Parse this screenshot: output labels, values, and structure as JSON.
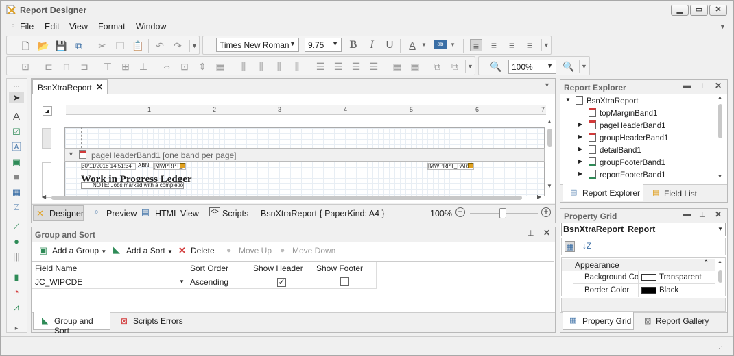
{
  "window": {
    "title": "Report Designer"
  },
  "menu": [
    "File",
    "Edit",
    "View",
    "Format",
    "Window"
  ],
  "format_toolbar": {
    "font_name": "Times New Roman",
    "font_size": "9.75"
  },
  "layout_toolbar": {
    "zoom": "100%"
  },
  "document_tab": {
    "label": "BsnXtraReport"
  },
  "designer": {
    "ruler_numbers": [
      "1",
      "2",
      "3",
      "4",
      "5",
      "6",
      "7"
    ],
    "band_caption": "pageHeaderBand1 [one band per page]",
    "controls": {
      "date_field": "30/11/2018 14:51:34",
      "abn_label": "ABN:",
      "abn_field": "[MWPRPT_",
      "param_field": "[MWPRPT_PARA",
      "title_text": "Work in Progress Ledger",
      "note_text": "NOTE: Jobs marked with a completio"
    }
  },
  "designer_tabs": {
    "designer": "Designer",
    "preview": "Preview",
    "html_view": "HTML View",
    "scripts": "Scripts",
    "status": "BsnXtraReport { PaperKind: A4 }",
    "zoom": "100%"
  },
  "group_sort": {
    "title": "Group and Sort",
    "buttons": {
      "add_group": "Add a Group",
      "add_sort": "Add a Sort",
      "delete": "Delete",
      "move_up": "Move Up",
      "move_down": "Move Down"
    },
    "columns": [
      "Field Name",
      "Sort Order",
      "Show Header",
      "Show Footer"
    ],
    "rows": [
      {
        "field": "JC_WIPCDE",
        "order": "Ascending",
        "show_header": true,
        "show_footer": false
      }
    ],
    "tabs": {
      "group_sort": "Group and Sort",
      "scripts_errors": "Scripts Errors"
    }
  },
  "report_explorer": {
    "title": "Report Explorer",
    "root": "BsnXtraReport",
    "items": [
      "topMarginBand1",
      "pageHeaderBand1",
      "groupHeaderBand1",
      "detailBand1",
      "groupFooterBand1",
      "reportFooterBand1"
    ],
    "tabs": {
      "explorer": "Report Explorer",
      "field_list": "Field List"
    }
  },
  "property_grid": {
    "title": "Property Grid",
    "object_name": "BsnXtraReport",
    "object_type": "Report",
    "category": "Appearance",
    "properties": [
      {
        "name": "Background Colo",
        "value": "Transparent",
        "swatch": "#ffffff"
      },
      {
        "name": "Border Color",
        "value": "Black",
        "swatch": "#000000"
      }
    ],
    "tabs": {
      "property_grid": "Property Grid",
      "report_gallery": "Report Gallery"
    }
  },
  "colors": {
    "accent": "#3a6ea5",
    "red": "#d23a3a",
    "green": "#2e8b57"
  }
}
